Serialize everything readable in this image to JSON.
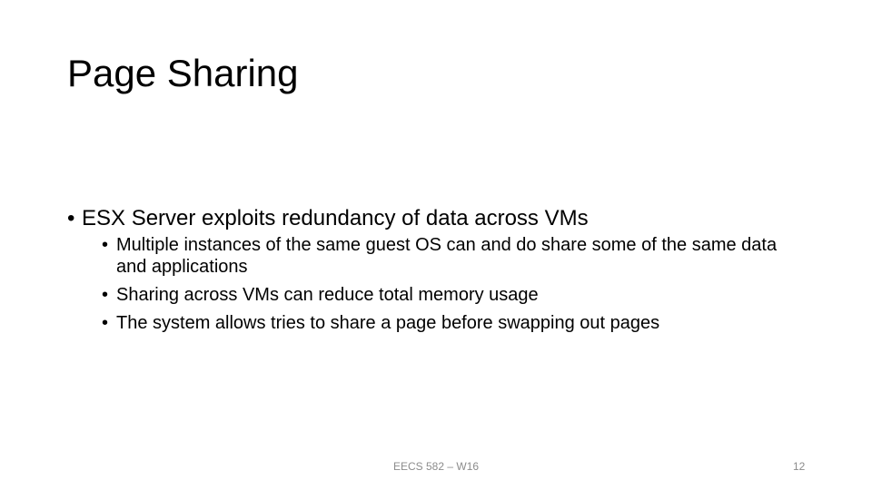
{
  "slide": {
    "title": "Page Sharing",
    "bullets": [
      {
        "text": "ESX Server exploits redundancy of data across VMs",
        "sub": [
          {
            "text": "Multiple instances of the same guest OS can and do share some of the same data and applications"
          },
          {
            "text": "Sharing across VMs can reduce total memory usage"
          },
          {
            "text": "The system allows tries to share a page before swapping out pages"
          }
        ]
      }
    ],
    "bullet_glyph": "•"
  },
  "footer": {
    "course": "EECS 582 – W16",
    "page_number": "12"
  }
}
